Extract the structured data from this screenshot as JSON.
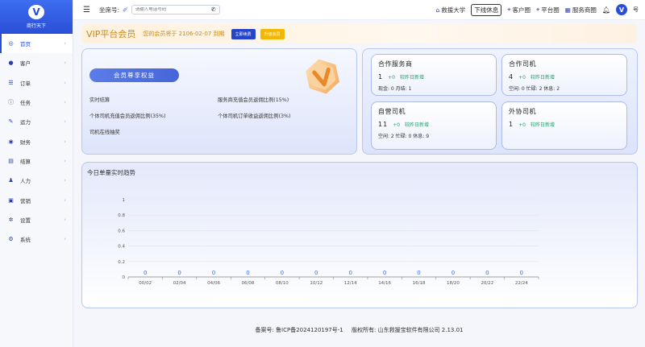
{
  "sidebar": {
    "logo_text": "商行天下",
    "items": [
      {
        "label": "首页",
        "icon": "compass-icon",
        "glyph": "◎",
        "active": true
      },
      {
        "label": "客户",
        "icon": "user-icon",
        "glyph": "●"
      },
      {
        "label": "订单",
        "icon": "list-icon",
        "glyph": "☰"
      },
      {
        "label": "任务",
        "icon": "info-icon",
        "glyph": "ⓘ"
      },
      {
        "label": "运力",
        "icon": "edit-icon",
        "glyph": "✎"
      },
      {
        "label": "财务",
        "icon": "globe-icon",
        "glyph": "◉"
      },
      {
        "label": "结算",
        "icon": "document-icon",
        "glyph": "▤"
      },
      {
        "label": "人力",
        "icon": "person-icon",
        "glyph": "♟"
      },
      {
        "label": "营销",
        "icon": "cart-icon",
        "glyph": "▣"
      },
      {
        "label": "设置",
        "icon": "gear-icon",
        "glyph": "✲"
      },
      {
        "label": "系统",
        "icon": "settings-icon",
        "glyph": "⚙"
      }
    ]
  },
  "header": {
    "seat_label": "坐席号:",
    "phone_placeholder": "请输入电话号码",
    "links": [
      {
        "label": "救援大学",
        "icon": "building-icon",
        "glyph": "⌂"
      },
      {
        "label": "客户圈",
        "icon": "location-icon",
        "glyph": "⌖"
      },
      {
        "label": "平台圈",
        "icon": "location-icon",
        "glyph": "⌖"
      },
      {
        "label": "服务商圈",
        "icon": "grid-icon",
        "glyph": "▦"
      }
    ],
    "offline_button": "下线休息",
    "user_name": "号"
  },
  "vip": {
    "title": "VIP平台会员",
    "expire_text": "您的会员将于 2106-02-07 到期",
    "renew_button": "立即续费",
    "upgrade_button": "升级会员"
  },
  "benefits": {
    "title_button": "会员尊享权益",
    "items": [
      "实时结算",
      "服务商充值会员返佣比例(15%)",
      "个体司机充值会员返佣比例(35%)",
      "个体司机订单收益返佣比例(3%)",
      "司机在线抽奖"
    ]
  },
  "stats": [
    {
      "title": "合作服务商",
      "num": "1",
      "plus": "+0",
      "note": "较昨日新增",
      "sub": "现金: 0 月结: 1"
    },
    {
      "title": "合作司机",
      "num": "4",
      "plus": "+0",
      "note": "较昨日新增",
      "sub": "空闲: 0 忙碌: 2 休息: 2"
    },
    {
      "title": "自营司机",
      "num": "11",
      "plus": "+0",
      "note": "较昨日新增",
      "sub": "空闲: 2 忙碌: 0 休息: 9"
    },
    {
      "title": "外协司机",
      "num": "1",
      "plus": "+0",
      "note": "较昨日新增",
      "sub": ""
    }
  ],
  "trend": {
    "title": "今日单量实时趋势"
  },
  "chart_data": {
    "type": "bar",
    "title": "今日单量实时趋势",
    "categories": [
      "00/02",
      "02/04",
      "04/06",
      "06/08",
      "08/10",
      "10/12",
      "12/14",
      "14/16",
      "16/18",
      "18/20",
      "20/22",
      "22/24"
    ],
    "values": [
      0,
      0,
      0,
      0,
      0,
      0,
      0,
      0,
      0,
      0,
      0,
      0
    ],
    "yticks": [
      "0",
      "0.2",
      "0.4",
      "0.6",
      "0.8",
      "1"
    ],
    "ylim": [
      0,
      1
    ],
    "grid": true,
    "label_color": "#3a6ae0"
  },
  "footer": {
    "icp": "备案号: 鲁ICP备2024120197号-1",
    "copyright": "版权所有: 山东救援宝软件有限公司 2.13.01"
  }
}
